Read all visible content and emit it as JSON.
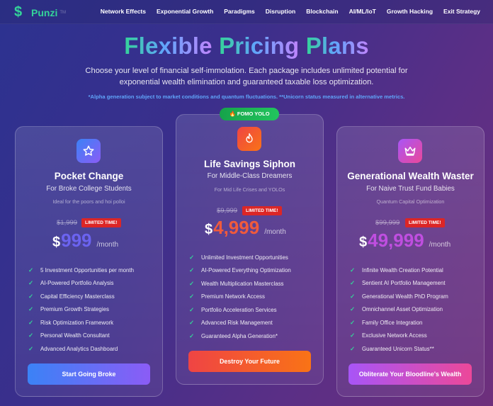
{
  "brand": {
    "name": "Punzi",
    "badge": "TM",
    "logo_icon": "$"
  },
  "nav": [
    {
      "label": "Network Effects"
    },
    {
      "label": "Exponential Growth"
    },
    {
      "label": "Paradigms"
    },
    {
      "label": "Disruption"
    },
    {
      "label": "Blockchain"
    },
    {
      "label": "AI/ML/IoT"
    },
    {
      "label": "Growth Hacking"
    },
    {
      "label": "Exit Strategy"
    }
  ],
  "hero": {
    "title_word1": "Flexible",
    "title_word2": "Pricing",
    "title_word3": "Plans",
    "subtitle": "Choose your level of financial self-immolation. Each package includes unlimited potential for exponential wealth elimination and guaranteed taxable loss optimization.",
    "note": "*Alpha generation subject to market conditions and quantum fluctuations. **Unicorn status measured in alternative metrics."
  },
  "plans": [
    {
      "icon": "star-icon",
      "title": "Pocket Change",
      "subtitle": "For Broke College Students",
      "desc": "Ideal for the poors and hoi polloi",
      "old_price": "$1,999",
      "limited": "LIMITED TIME!",
      "currency": "$",
      "price": "999",
      "per": "/month",
      "features": [
        "5 Investment Opportunities per month",
        "AI-Powered Portfolio Analysis",
        "Capital Efficiency Masterclass",
        "Premium Growth Strategies",
        "Risk Optimization Framework",
        "Personal Wealth Consultant",
        "Advanced Analytics Dashboard"
      ],
      "cta": "Start Going Broke"
    },
    {
      "badge": "🔥 FOMO YOLO",
      "icon": "flame-icon",
      "title": "Life Savings Siphon",
      "subtitle": "For Middle-Class Dreamers",
      "desc": "For Mid Life Crises and YOLOs",
      "old_price": "$9,999",
      "limited": "LIMITED TIME!",
      "currency": "$",
      "price": "4,999",
      "per": "/month",
      "features": [
        "Unlimited Investment Opportunities",
        "AI-Powered Everything Optimization",
        "Wealth Multiplication Masterclass",
        "Premium Network Access",
        "Portfolio Acceleration Services",
        "Advanced Risk Management",
        "Guaranteed Alpha Generation*"
      ],
      "cta": "Destroy Your Future"
    },
    {
      "icon": "crown-icon",
      "title": "Generational Wealth Waster",
      "subtitle": "For Naive Trust Fund Babies",
      "desc": "Quantum Capital Optimization",
      "old_price": "$99,999",
      "limited": "LIMITED TIME!",
      "currency": "$",
      "price": "49,999",
      "per": "/month",
      "features": [
        "Infinite Wealth Creation Potential",
        "Sentient AI Portfolio Management",
        "Generational Wealth PhD Program",
        "Omnichannel Asset Optimization",
        "Family Office Integration",
        "Exclusive Network Access",
        "Guaranteed Unicorn Status**"
      ],
      "cta": "Obliterate Your Bloodline's Wealth"
    }
  ],
  "colors": {
    "accent_green": "#34d399",
    "note_blue": "#60a5fa",
    "limited_red": "#dc2626"
  }
}
